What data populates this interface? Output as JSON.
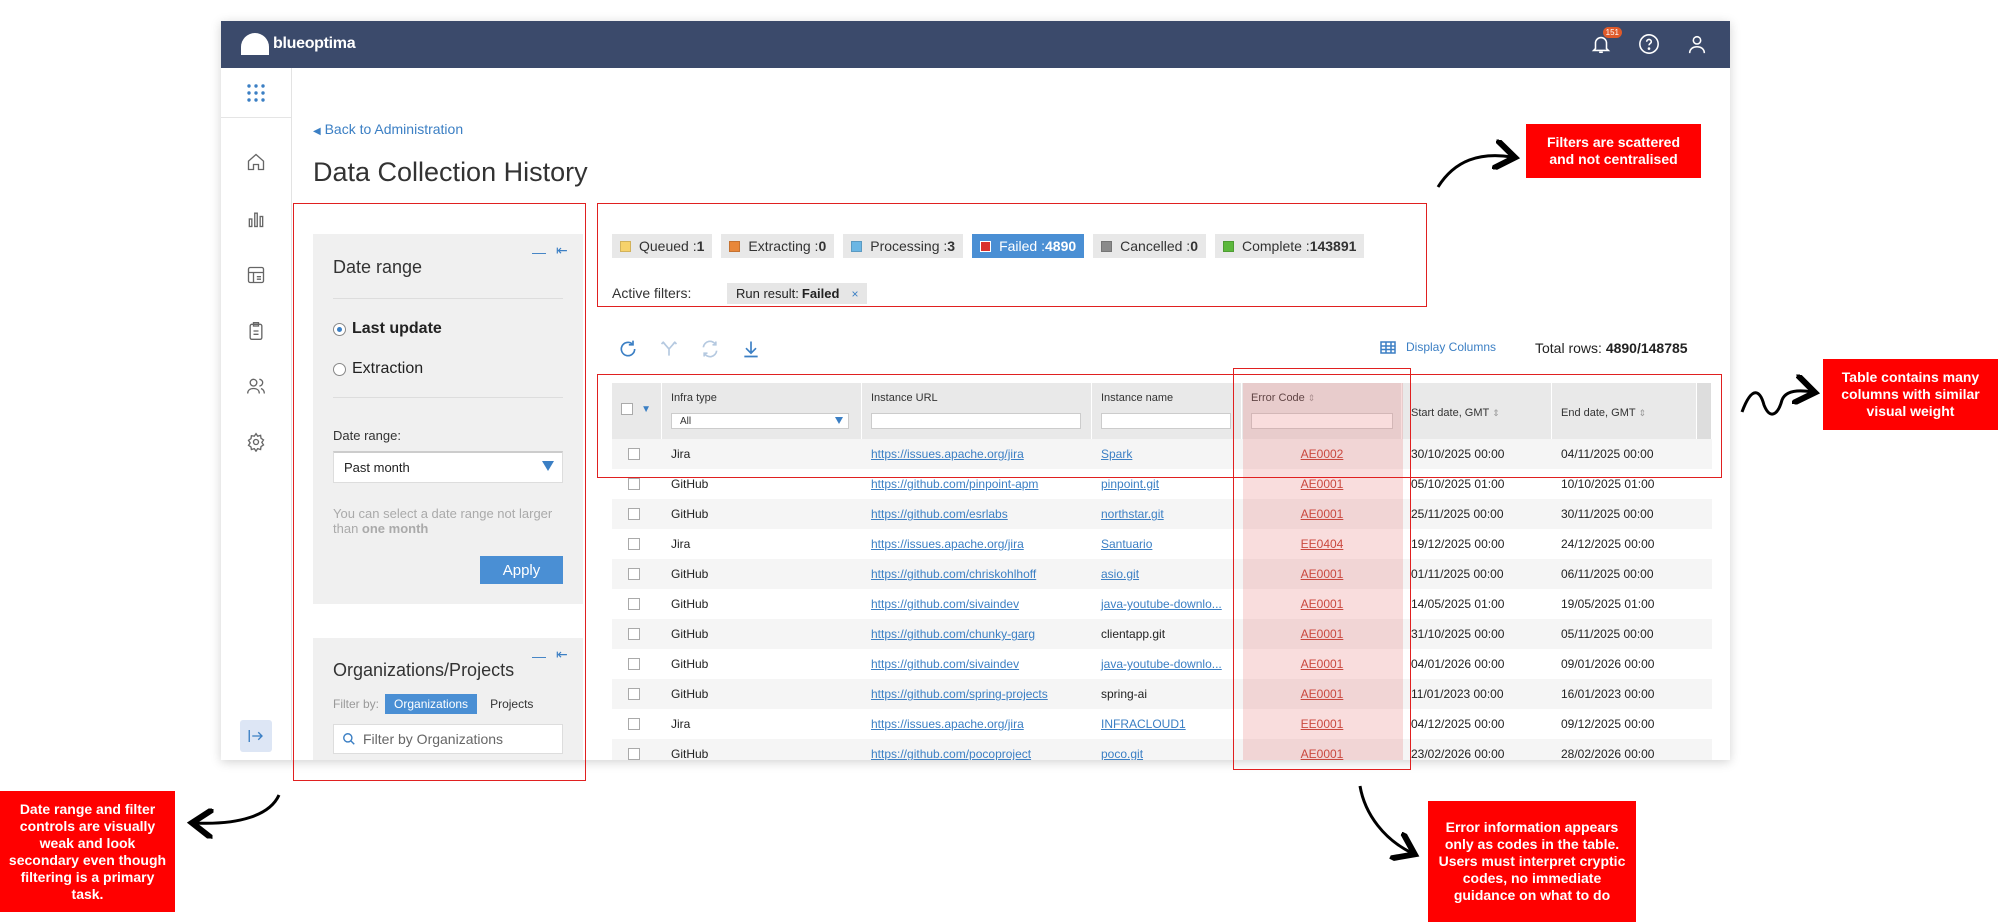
{
  "brand": {
    "name": "blueoptima"
  },
  "header": {
    "notifications_count": "151",
    "icons": [
      "bell-icon",
      "help-icon",
      "user-icon"
    ]
  },
  "nav": {
    "items": [
      "apps-grid-icon",
      "home-icon",
      "bar-chart-icon",
      "report-icon",
      "clipboard-icon",
      "users-icon",
      "settings-icon"
    ],
    "collapse": "collapse-icon"
  },
  "back_link": "Back to Administration",
  "page_title": "Data Collection History",
  "date_panel": {
    "title": "Date range",
    "radio_last_update": "Last update",
    "radio_extraction": "Extraction",
    "date_range_label": "Date range:",
    "date_range_value": "Past month",
    "hint_prefix": "You can select a date range not larger than ",
    "hint_bold": "one month",
    "apply": "Apply"
  },
  "org_panel": {
    "title": "Organizations/Projects",
    "filter_by": "Filter by:",
    "seg_orgs": "Organizations",
    "seg_projects": "Projects",
    "search_placeholder": "Filter by Organizations"
  },
  "status_chips": [
    {
      "label": "Queued :",
      "count": "1",
      "color": "#f7d26b"
    },
    {
      "label": "Extracting :",
      "count": "0",
      "color": "#e8873a"
    },
    {
      "label": "Processing :",
      "count": "3",
      "color": "#6bb6e4"
    },
    {
      "label": "Failed :",
      "count": "4890",
      "color": "#d9302c"
    },
    {
      "label": "Cancelled :",
      "count": "0",
      "color": "#8a8a8a"
    },
    {
      "label": "Complete :",
      "count": "143891",
      "color": "#5cb83c"
    }
  ],
  "active_filters": {
    "label": "Active filters:",
    "chip_prefix": "Run result: ",
    "chip_value": "Failed",
    "remove": "×"
  },
  "toolbar": {
    "icons": [
      "refresh-icon",
      "merge-icon",
      "sync-icon",
      "download-icon"
    ],
    "display_columns": "Display Columns",
    "total_rows_label": "Total rows: ",
    "total_rows_value": "4890/148785"
  },
  "table": {
    "headers": {
      "infra_type": "Infra type",
      "infra_filter": "All",
      "instance_url": "Instance URL",
      "instance_name": "Instance name",
      "error_code": "Error Code",
      "start_date": "Start date, GMT",
      "end_date": "End date, GMT"
    },
    "rows": [
      {
        "infra": "Jira",
        "url": "https://issues.apache.org/jira",
        "name": "Spark",
        "name_link": true,
        "code": "AE0002",
        "start": "30/10/2025 00:00",
        "end": "04/11/2025 00:00"
      },
      {
        "infra": "GitHub",
        "url": "https://github.com/pinpoint-apm",
        "name": "pinpoint.git",
        "name_link": true,
        "code": "AE0001",
        "start": "05/10/2025 01:00",
        "end": "10/10/2025 01:00"
      },
      {
        "infra": "GitHub",
        "url": "https://github.com/esrlabs",
        "name": "northstar.git",
        "name_link": true,
        "code": "AE0001",
        "start": "25/11/2025 00:00",
        "end": "30/11/2025 00:00"
      },
      {
        "infra": "Jira",
        "url": "https://issues.apache.org/jira",
        "name": "Santuario",
        "name_link": true,
        "code": "EE0404",
        "start": "19/12/2025 00:00",
        "end": "24/12/2025 00:00"
      },
      {
        "infra": "GitHub",
        "url": "https://github.com/chriskohlhoff",
        "name": "asio.git",
        "name_link": true,
        "code": "AE0001",
        "start": "01/11/2025 00:00",
        "end": "06/11/2025 00:00"
      },
      {
        "infra": "GitHub",
        "url": "https://github.com/sivaindev",
        "name": "java-youtube-downlo...",
        "name_link": true,
        "code": "AE0001",
        "start": "14/05/2025 01:00",
        "end": "19/05/2025 01:00"
      },
      {
        "infra": "GitHub",
        "url": "https://github.com/chunky-garg",
        "name": "clientapp.git",
        "name_link": false,
        "code": "AE0001",
        "start": "31/10/2025 00:00",
        "end": "05/11/2025 00:00"
      },
      {
        "infra": "GitHub",
        "url": "https://github.com/sivaindev",
        "name": "java-youtube-downlo...",
        "name_link": true,
        "code": "AE0001",
        "start": "04/01/2026 00:00",
        "end": "09/01/2026 00:00"
      },
      {
        "infra": "GitHub",
        "url": "https://github.com/spring-projects",
        "name": "spring-ai",
        "name_link": false,
        "code": "AE0001",
        "start": "11/01/2023 00:00",
        "end": "16/01/2023 00:00"
      },
      {
        "infra": "Jira",
        "url": "https://issues.apache.org/jira",
        "name": "INFRACLOUD1",
        "name_link": true,
        "code": "EE0001",
        "start": "04/12/2025 00:00",
        "end": "09/12/2025 00:00"
      },
      {
        "infra": "GitHub",
        "url": "https://github.com/pocoproject",
        "name": "poco.git",
        "name_link": true,
        "code": "AE0001",
        "start": "23/02/2026 00:00",
        "end": "28/02/2026 00:00"
      }
    ]
  },
  "annotations": {
    "filters": "Filters are scattered and not centralised",
    "table": "Table contains many columns with similar visual weight",
    "date": "Date range and filter controls are visually weak and look secondary even though filtering is a primary task.",
    "error": "Error information appears only as codes in the table. Users must interpret cryptic codes, no immediate guidance on what to do"
  }
}
